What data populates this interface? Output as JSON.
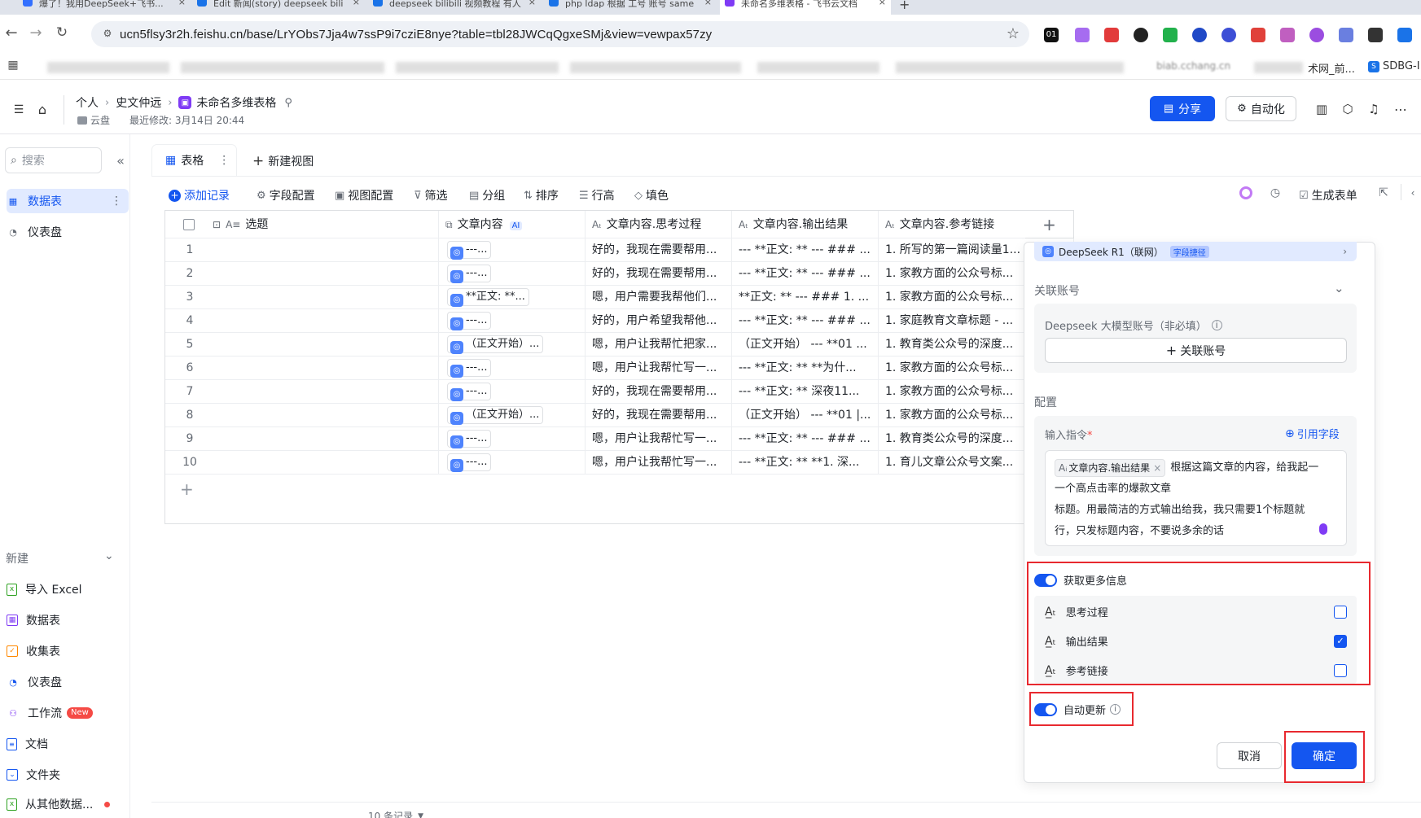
{
  "browser": {
    "tabs": [
      {
        "label": "爆了！我用DeepSeek+飞书...",
        "close": "×"
      },
      {
        "label": "Edit 新闻(story) deepseek bili",
        "close": "×"
      },
      {
        "label": "deepseek bilibili 视频教程 有人",
        "close": "×"
      },
      {
        "label": "php ldap 根据 工号 账号 same",
        "close": "×"
      },
      {
        "label": "未命名多维表格 - 飞书云文档",
        "close": "×"
      }
    ],
    "new_tab": "+",
    "url": "ucn5flsy3r2h.feishu.cn/base/LrYObs7Jja4w7ssP9i7cziE8nye?table=tbl28JWCqQgxeSMj&view=vewpax57zy",
    "bookmarks_visible": [
      "biab.cchang.cn",
      "术网_前...",
      "SDBG-I"
    ]
  },
  "header": {
    "breadcrumb": [
      "个人",
      "史文仲远",
      "未命名多维表格"
    ],
    "location": "云盘",
    "last_modified": "最近修改: 3月14日 20:44",
    "share_label": "分享",
    "automation_label": "自动化"
  },
  "sidebar": {
    "search_placeholder": "搜索",
    "items": [
      {
        "label": "数据表",
        "icon": "table-icon"
      },
      {
        "label": "仪表盘",
        "icon": "dashboard-icon"
      }
    ],
    "new_section": "新建",
    "new_items": [
      {
        "label": "导入 Excel",
        "icon": "excel-icon",
        "color": "#2ea121"
      },
      {
        "label": "数据表",
        "icon": "table-icon",
        "color": "#7f3bf5"
      },
      {
        "label": "收集表",
        "icon": "form-icon",
        "color": "#ff8800"
      },
      {
        "label": "仪表盘",
        "icon": "dashboard-icon",
        "color": "#1456f0"
      },
      {
        "label": "工作流",
        "icon": "workflow-icon",
        "color": "#7f3bf5",
        "badge": "New"
      },
      {
        "label": "文档",
        "icon": "doc-icon",
        "color": "#1456f0"
      },
      {
        "label": "文件夹",
        "icon": "folder-icon",
        "color": "#1456f0"
      },
      {
        "label": "从其他数据...",
        "icon": "import-icon",
        "color": "#2ea121"
      }
    ]
  },
  "view": {
    "tab_label": "表格",
    "new_view_label": "新建视图",
    "toolbar": {
      "add_record": "添加记录",
      "field_config": "字段配置",
      "view_config": "视图配置",
      "filter": "筛选",
      "group": "分组",
      "sort": "排序",
      "row_height": "行高",
      "fill_color": "填色",
      "generate_form": "生成表单"
    }
  },
  "table": {
    "columns": [
      "选题",
      "文章内容",
      "文章内容.思考过程",
      "文章内容.输出结果",
      "文章内容.参考链接"
    ],
    "ai_badge": "AI",
    "add_column": "+",
    "add_row": "+",
    "rows": [
      {
        "n": "1",
        "content": "---...",
        "think": "好的，我现在需要帮用...",
        "out": "--- **正文: ** --- ### ...",
        "ref": "1. 所写的第一篇阅读量1..."
      },
      {
        "n": "2",
        "content": "---...",
        "think": "好的，我现在需要帮用...",
        "out": "--- **正文: ** --- ### ...",
        "ref": "1. 家教方面的公众号标..."
      },
      {
        "n": "3",
        "content": "**正文: **...",
        "think": "嗯，用户需要我帮他们...",
        "out": "**正文: ** --- ### 1. ...",
        "ref": "1. 家教方面的公众号标..."
      },
      {
        "n": "4",
        "content": "---...",
        "think": "好的，用户希望我帮他...",
        "out": "--- **正文: ** --- ### ...",
        "ref": "1. 家庭教育文章标题 - ..."
      },
      {
        "n": "5",
        "content": "（正文开始）...",
        "think": "嗯，用户让我帮忙把家...",
        "out": "（正文开始） --- **01 ...",
        "ref": "1. 教育类公众号的深度..."
      },
      {
        "n": "6",
        "content": "---...",
        "think": "嗯，用户让我帮忙写一...",
        "out": "--- **正文: ** **为什...",
        "ref": "1. 家教方面的公众号标..."
      },
      {
        "n": "7",
        "content": "---...",
        "think": "好的，我现在需要帮用...",
        "out": "--- **正文: ** 深夜11...",
        "ref": "1. 家教方面的公众号标..."
      },
      {
        "n": "8",
        "content": "（正文开始）...",
        "think": "好的，我现在需要帮用...",
        "out": "（正文开始） --- **01 |...",
        "ref": "1. 家教方面的公众号标..."
      },
      {
        "n": "9",
        "content": "---...",
        "think": "嗯，用户让我帮忙写一...",
        "out": "--- **正文: ** --- ### ...",
        "ref": "1. 教育类公众号的深度..."
      },
      {
        "n": "10",
        "content": "---...",
        "think": "嗯，用户让我帮忙写一...",
        "out": "--- **正文: ** **1. 深...",
        "ref": "1. 育儿文章公众号文案..."
      }
    ],
    "record_count": "10 条记录"
  },
  "panel": {
    "model_name": "DeepSeek R1（联网）",
    "model_tag": "字段捷径",
    "linked_account_title": "关联账号",
    "account_label": "Deepseek 大模型账号（非必填）",
    "link_account_button": "关联账号",
    "config_title": "配置",
    "instruction_label": "输入指令",
    "required_mark": "*",
    "ref_field_link": "引用字段",
    "instruction_chip": "文章内容.输出结果",
    "instruction_line1": "根据这篇文章的内容，给我起一",
    "instruction_line2": "一个高点击率的爆款文章",
    "instruction_line3": "标题。用最简洁的方式输出给我，我只需要1个标题就",
    "instruction_line4": "行，只发标题内容，不要说多余的话",
    "more_info_label": "获取更多信息",
    "more_info_enabled": true,
    "options": [
      {
        "label": "思考过程",
        "checked": false
      },
      {
        "label": "输出结果",
        "checked": true
      },
      {
        "label": "参考链接",
        "checked": false
      }
    ],
    "auto_update_label": "自动更新",
    "auto_update_enabled": true,
    "cancel_label": "取消",
    "confirm_label": "确定"
  },
  "colors": {
    "primary": "#1456f0",
    "highlight_red": "#e8292f",
    "purple_app": "#7f3bf5"
  }
}
